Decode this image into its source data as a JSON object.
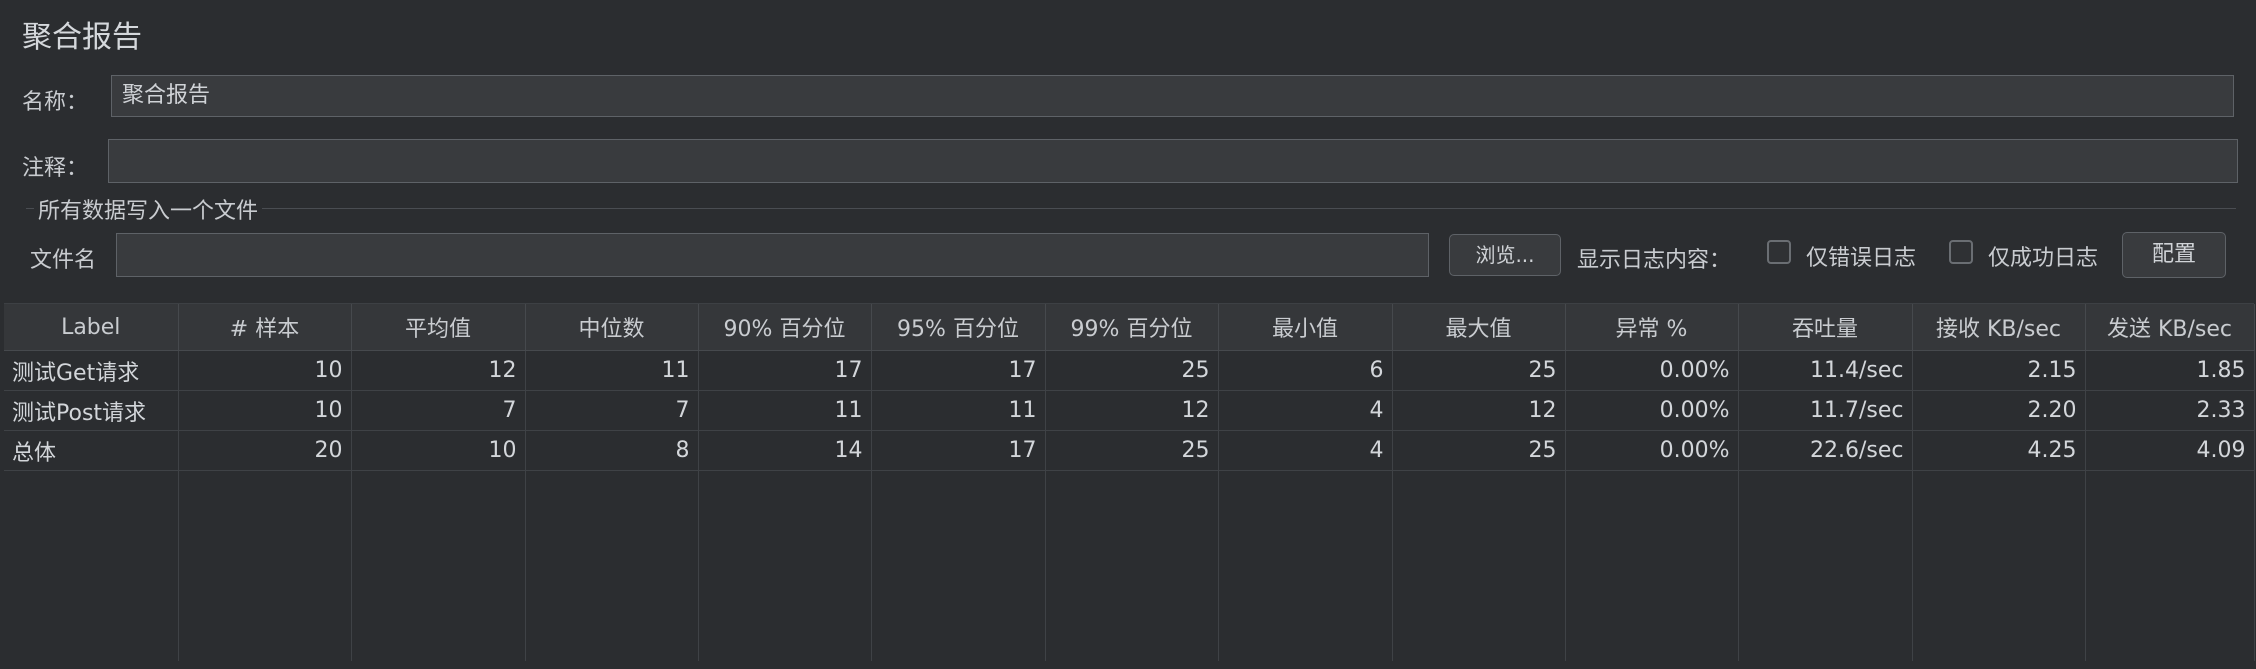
{
  "window": {
    "title": "聚合报告"
  },
  "form": {
    "name_label": "名称：",
    "name_value": "聚合报告",
    "comment_label": "注释：",
    "comment_value": "",
    "section_title": "所有数据写入一个文件",
    "filename_label": "文件名",
    "filename_value": "",
    "browse_label": "浏览...",
    "log_content_label": "显示日志内容：",
    "errors_only_label": "仅错误日志",
    "errors_only_checked": false,
    "success_only_label": "仅成功日志",
    "success_only_checked": false,
    "config_label": "配置"
  },
  "table": {
    "columns": [
      "Label",
      "# 样本",
      "平均值",
      "中位数",
      "90% 百分位",
      "95% 百分位",
      "99% 百分位",
      "最小值",
      "最大值",
      "异常 %",
      "吞吐量",
      "接收 KB/sec",
      "发送 KB/sec"
    ],
    "rows": [
      [
        "测试Get请求",
        "10",
        "12",
        "11",
        "17",
        "17",
        "25",
        "6",
        "25",
        "0.00%",
        "11.4/sec",
        "2.15",
        "1.85"
      ],
      [
        "测试Post请求",
        "10",
        "7",
        "7",
        "11",
        "11",
        "12",
        "4",
        "12",
        "0.00%",
        "11.7/sec",
        "2.20",
        "2.33"
      ],
      [
        "总体",
        "20",
        "10",
        "8",
        "14",
        "17",
        "25",
        "4",
        "25",
        "0.00%",
        "22.6/sec",
        "4.25",
        "4.09"
      ]
    ]
  }
}
